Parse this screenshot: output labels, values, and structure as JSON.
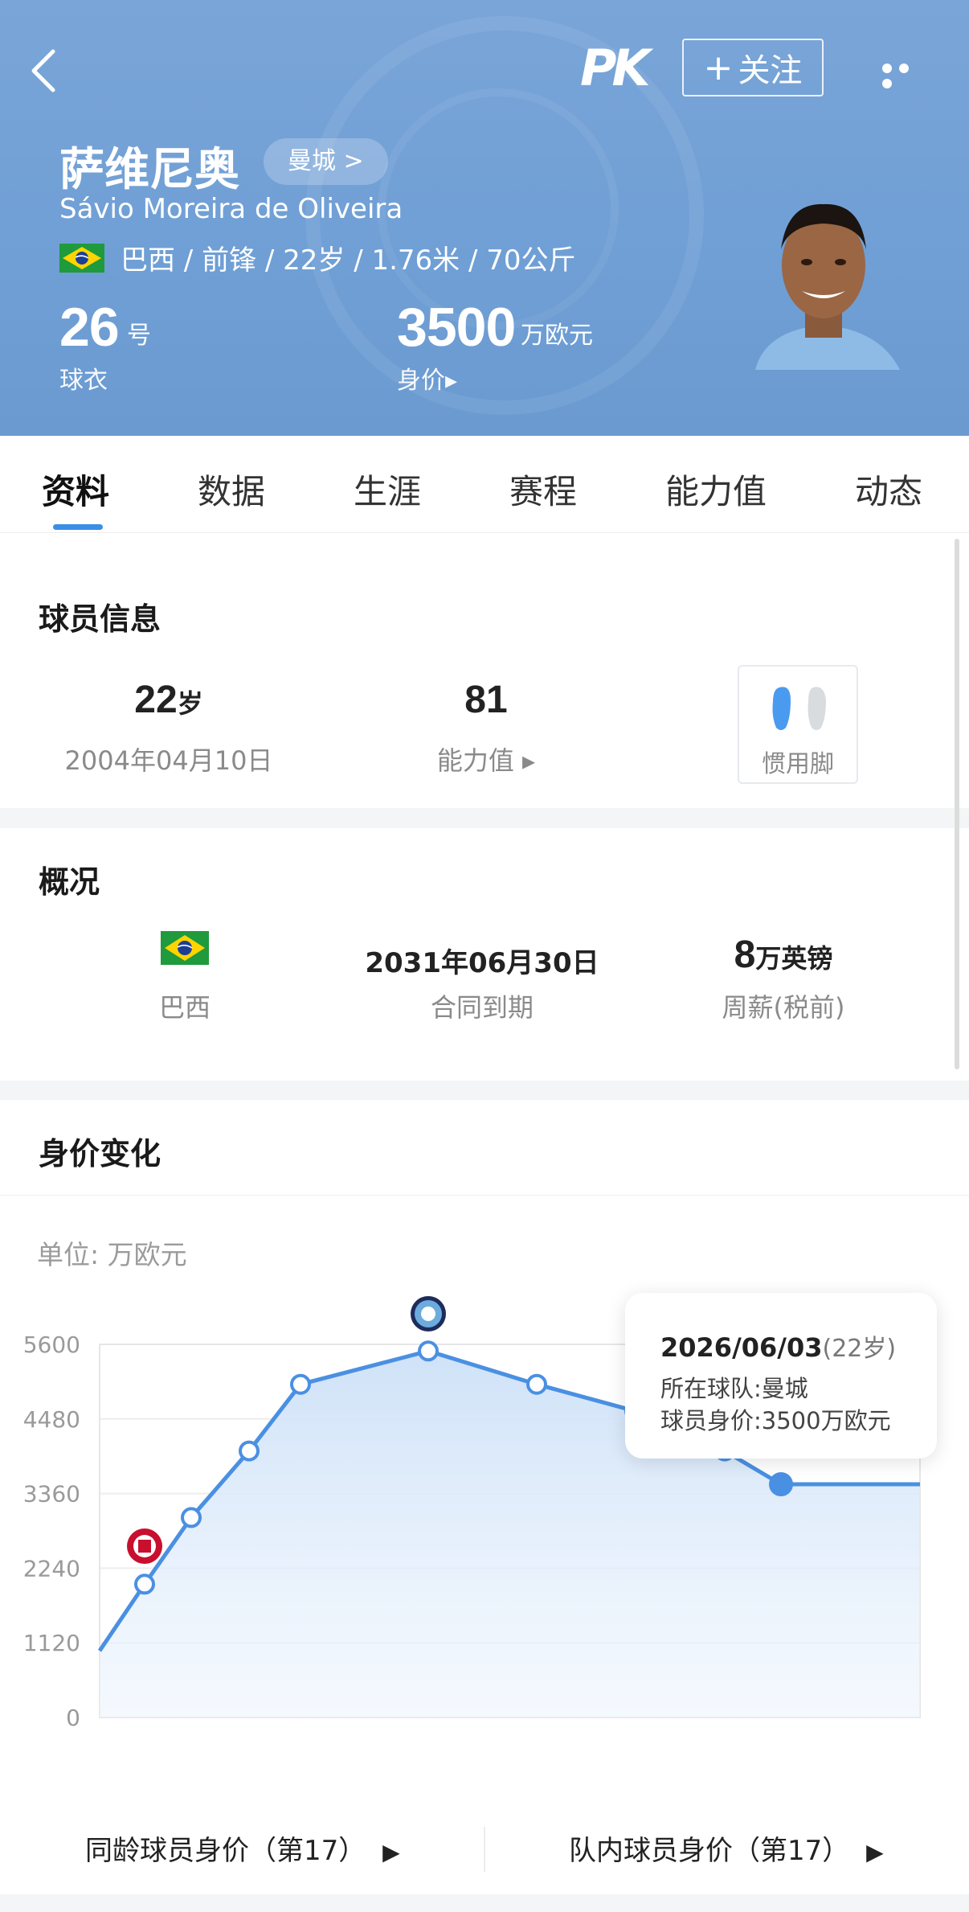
{
  "header": {
    "logo_text": "PK",
    "follow_label": "关注",
    "follow_plus": "+",
    "player_name_cn": "萨维尼奥",
    "team_link": "曼城 >",
    "player_name_latin": "Sávio Moreira de Oliveira",
    "meta": "巴西 / 前锋 / 22岁 / 1.76米 / 70公斤",
    "shirt_number": "26",
    "shirt_unit": "号",
    "shirt_label": "球衣",
    "market_value": "3500",
    "market_value_unit": "万欧元",
    "market_value_label": "身价▸"
  },
  "tabs": [
    "资料",
    "数据",
    "生涯",
    "赛程",
    "能力值",
    "动态"
  ],
  "player_info": {
    "title": "球员信息",
    "age_num": "22",
    "age_unit": "岁",
    "birthday": "2004年04月10日",
    "ability_num": "81",
    "ability_label": "能力值 ▸",
    "foot_label": "惯用脚"
  },
  "overview": {
    "title": "概况",
    "country": "巴西",
    "contract_date": "2031年06月30日",
    "contract_label": "合同到期",
    "salary_num": "8",
    "salary_unit": "万英镑",
    "salary_label": "周薪(税前)"
  },
  "value_chart": {
    "title": "身价变化",
    "unit_label": "单位:  万欧元",
    "tooltip": {
      "date": "2026/06/03",
      "age": "(22岁)",
      "team_line": "所在球队:曼城",
      "value_line": "球员身价:3500万欧元"
    }
  },
  "chart_data": {
    "type": "area",
    "title": "",
    "xlabel": "",
    "ylabel": "",
    "ylim": [
      0,
      5600
    ],
    "yticks": [
      0,
      1120,
      2240,
      3360,
      4480,
      5600
    ],
    "series": [
      {
        "values": [
          1000,
          2000,
          3000,
          4000,
          5000,
          5500,
          5000,
          4600,
          4000,
          3500,
          3500
        ]
      }
    ],
    "grid": true,
    "line_color": "#4a90e2",
    "fill_color": "#cfe2f8"
  },
  "bottom": {
    "same_age_rank": "同龄球员身价（第17）",
    "team_rank": "队内球员身价（第17）"
  },
  "colors": {
    "header_bg": "#6f9fd5",
    "accent": "#3a8ee6",
    "line": "#4a90e2"
  }
}
